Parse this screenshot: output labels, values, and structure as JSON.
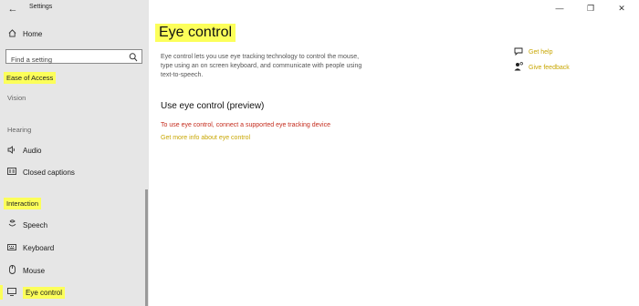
{
  "window": {
    "title": "Settings",
    "minimize_glyph": "—",
    "restore_glyph": "❐",
    "close_glyph": "✕"
  },
  "sidebar": {
    "home": {
      "label": "Home",
      "icon": "home-icon"
    },
    "search": {
      "placeholder": "Find a setting",
      "icon": "search-icon"
    },
    "category": "Ease of Access",
    "sections": {
      "vision": "Vision",
      "hearing": "Hearing",
      "interaction": "Interaction"
    },
    "items": [
      {
        "label": "Audio",
        "icon": "speaker-icon"
      },
      {
        "label": "Closed captions",
        "icon": "closed-captions-icon"
      },
      {
        "label": "Speech",
        "icon": "microphone-icon"
      },
      {
        "label": "Keyboard",
        "icon": "keyboard-icon"
      },
      {
        "label": "Mouse",
        "icon": "mouse-icon"
      },
      {
        "label": "Eye control",
        "icon": "eye-control-icon",
        "selected": true
      }
    ]
  },
  "main": {
    "title": "Eye control",
    "description": "Eye control lets you use eye tracking technology to control the mouse, type using an on screen keyboard, and communicate with people using text-to-speech.",
    "section_heading": "Use eye control (preview)",
    "error_text": "To use eye control, connect a supported eye tracking device",
    "info_link": "Get more info about eye control"
  },
  "help": {
    "get_help": "Get help",
    "give_feedback": "Give feedback"
  },
  "colors": {
    "highlight": "#fcff5a",
    "link": "#c8a600",
    "error": "#c42b1c",
    "sidebar_bg": "#e6e6e6"
  }
}
